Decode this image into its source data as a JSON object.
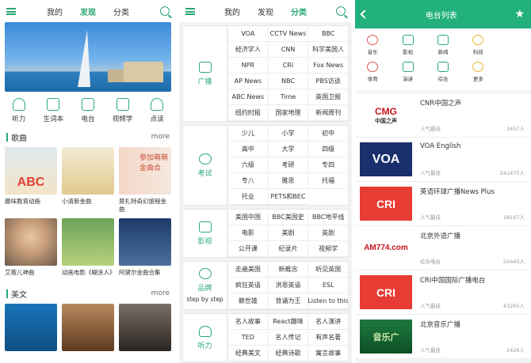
{
  "panel1": {
    "tabs": [
      "我的",
      "发现",
      "分类"
    ],
    "active_tab": "发现",
    "quick": [
      "听力",
      "生词本",
      "电台",
      "视频学",
      "点读"
    ],
    "sections": [
      {
        "title": "歌曲",
        "more": "more",
        "items": [
          "趣味教育动画",
          "小清新金曲",
          "莫扎特奇幻旅程金曲",
          "艾薇儿神曲",
          "动画电影《糊涂人》",
          "阿黛尔金曲合集"
        ]
      },
      {
        "title": "美文",
        "more": "more"
      }
    ],
    "card_texts": [
      "ABC",
      "参加萌萌 金曲合"
    ]
  },
  "panel2": {
    "tabs": [
      "我的",
      "发现",
      "分类"
    ],
    "active_tab": "分类",
    "categories": [
      {
        "name": "广播",
        "items": [
          "VOA",
          "CCTV News",
          "BBC",
          "经济学人",
          "CNN",
          "科学美国人",
          "NPR",
          "CRI",
          "Fox News",
          "AP News",
          "NBC",
          "PBS访谈",
          "ABC News",
          "Time",
          "英国卫报",
          "纽约时报",
          "国家地理",
          "新闻周刊"
        ]
      },
      {
        "name": "考试",
        "items": [
          "少儿",
          "小学",
          "初中",
          "高中",
          "大学",
          "四级",
          "六级",
          "考研",
          "专四",
          "专八",
          "雅思",
          "托福",
          "托业",
          "PETS和BEC"
        ]
      },
      {
        "name": "影视",
        "items": [
          "美国中国",
          "BBC美国史",
          "BBC地平线",
          "电影",
          "美剧",
          "英剧",
          "公开课",
          "纪录片",
          "视频学"
        ]
      },
      {
        "name": "品牌",
        "side_extra": "step by step",
        "items": [
          "走遍美国",
          "新概念",
          "听见英国",
          "疯狂英语",
          "洪恩英语",
          "ESL",
          "赖世雄",
          "背诵为王",
          "Listen to this"
        ]
      },
      {
        "name": "听力",
        "items": [
          "名人故事",
          "React趣味",
          "名人演讲",
          "TED",
          "名人传记",
          "有声名著",
          "经典美文",
          "经典诗歌",
          "寓言故事"
        ]
      }
    ]
  },
  "panel3": {
    "title": "电台列表",
    "categories": [
      "音乐",
      "影视",
      "新闻",
      "科技",
      "体育",
      "演讲",
      "综合",
      "更多"
    ],
    "stations": [
      {
        "name": "CNR中国之声",
        "meta": "人气最佳",
        "count": "3457人",
        "logo": "CMG",
        "logo_sub": "中国之声"
      },
      {
        "name": "VOA English",
        "meta": "人气最佳",
        "count": "242475人",
        "logo": "VOA"
      },
      {
        "name": "英语环球广播News Plus",
        "meta": "人气最佳",
        "count": "18167人",
        "logo": "CRI"
      },
      {
        "name": "北京外语广播",
        "meta": "综合电台",
        "count": "55645人",
        "logo": "AM774.com"
      },
      {
        "name": "CRI中国国际广播电台",
        "meta": "人气最佳",
        "count": "43265人",
        "logo": "CRI"
      },
      {
        "name": "北京音乐广播",
        "meta": "人气最佳",
        "count": "1426人",
        "logo": "音乐广"
      }
    ]
  },
  "colors": {
    "accent": "#2aa876",
    "header_green": "#22b07d"
  }
}
